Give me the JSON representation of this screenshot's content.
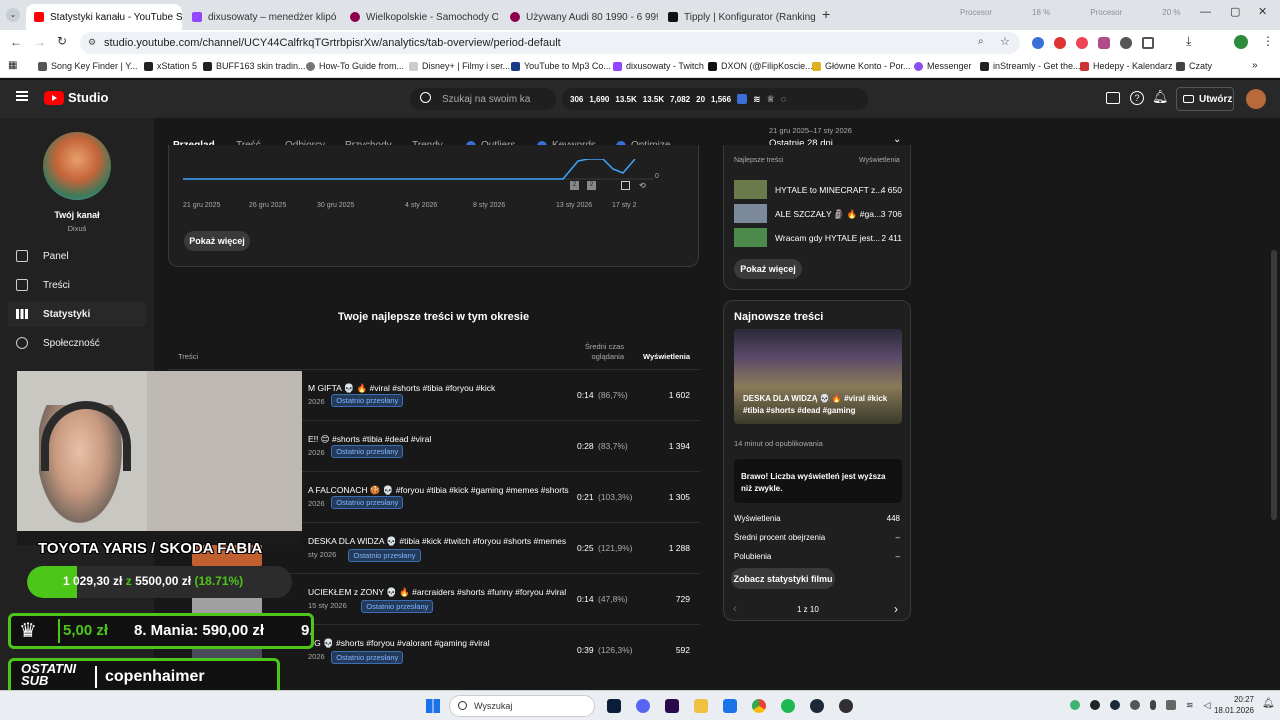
{
  "browser": {
    "tabs": [
      {
        "label": "Statystyki kanału - YouTube St",
        "active": true,
        "color": "#ff0000"
      },
      {
        "label": "dixusowaty – menedżer klipów",
        "active": false,
        "color": "#9146ff"
      },
      {
        "label": "Wielkopolskie - Samochody O",
        "active": false,
        "color": "#8b0050"
      },
      {
        "label": "Używany Audi 80 1990 - 6 999",
        "active": false,
        "color": "#8b0050"
      },
      {
        "label": "Tipply | Konfigurator (Ranking",
        "active": false,
        "color": "#111111"
      }
    ],
    "new_tab": "+",
    "url": "studio.youtube.com/channel/UCY44CalfrkqTGrtrbpisrXw/analytics/tab-overview/period-default",
    "bookmarks": [
      "Song Key Finder | Y...",
      "xStation 5",
      "BUFF163 skin tradin...",
      "How-To Guide from...",
      "Disney+ | Filmy i ser...",
      "YouTube to Mp3 Co...",
      "dixusowaty - Twitch",
      "DXON (@FilipKoscie...",
      "Główne Konto - Por...",
      "Messenger",
      "inStreamly - Get the...",
      "Hedepy - Kalendarz",
      "Czaty"
    ],
    "overlay_tiny": [
      "Procesor",
      "18 %",
      "Procesor",
      "20 %"
    ]
  },
  "studio": {
    "logo": "Studio",
    "search_placeholder": "Szukaj na swoim ka",
    "stats": [
      "306",
      "1,690",
      "13.5K",
      "13.5K",
      "7,082",
      "20",
      "1,566"
    ],
    "create_label": "Utwórz"
  },
  "sidebar": {
    "channel_label": "Twój kanał",
    "channel_name": "Dixuś",
    "items": [
      {
        "label": "Panel"
      },
      {
        "label": "Treści"
      },
      {
        "label": "Statystyki",
        "active": true
      },
      {
        "label": "Społeczność"
      }
    ]
  },
  "analytics": {
    "tabs": [
      "Przegląd",
      "Treść",
      "Odbiorcy",
      "Przychody",
      "Trendy",
      "Outliers",
      "Keywords",
      "Optimize"
    ],
    "period_range": "21 gru 2025–17 sty 2026",
    "period_label": "Ostatnie 28 dni",
    "chart_xticks": [
      "21 gru 2025",
      "26 gru 2025",
      "30 gru 2025",
      "4 sty 2026",
      "8 sty 2026",
      "13 sty 2026",
      "17 sty 2"
    ],
    "chart_zero": "0",
    "show_more": "Pokaż więcej",
    "top_content_title": "Twoje najlepsze treści w tym okresie",
    "col_content": "Treści",
    "col_avg": "Średni czas oglądania",
    "col_views": "Wyświetlenia",
    "rows": [
      {
        "title": "M GIFTA 💀 🔥 #viral #shorts #tibia #foryou #kick",
        "date": "2026",
        "badge": "Ostatnio przesłany",
        "avg": "0:14",
        "pct": "(86,7%)",
        "views": "1 602"
      },
      {
        "title": "E!! 😊 #shorts #tibia #dead #viral",
        "date": "2026",
        "badge": "Ostatnio przesłany",
        "avg": "0:28",
        "pct": "(83,7%)",
        "views": "1 394"
      },
      {
        "title": "A FALCONACH 🍪 💀 #foryou #tibia #kick #gaming #memes #shorts",
        "date": "2026",
        "badge": "Ostatnio przesłany",
        "avg": "0:21",
        "pct": "(103,3%)",
        "views": "1 305"
      },
      {
        "title": "DESKA DLA WIDZA 💀 #tibia #kick #twitch #foryou #shorts #memes",
        "date": "sty 2026",
        "badge": "Ostatnio przesłany",
        "avg": "0:25",
        "pct": "(121,9%)",
        "views": "1 288"
      },
      {
        "title": "UCIEKŁEM z ZONY 💀 🔥 #arcraiders #shorts #funny #foryou #viral",
        "date": "15 sty 2026",
        "badge": "Ostatnio przesłany",
        "avg": "0:14",
        "pct": "(47,8%)",
        "views": "729"
      },
      {
        "title": "NG 💀 #shorts #foryou #valorant #gaming #viral",
        "date": "2026",
        "badge": "Ostatnio przesłany",
        "avg": "0:39",
        "pct": "(126,3%)",
        "views": "592"
      }
    ]
  },
  "right": {
    "top_header_left": "Najlepsze treści",
    "top_header_right": "Wyświetlenia",
    "top_items": [
      {
        "title": "HYTALE to MINECRAFT z...",
        "views": "4 650"
      },
      {
        "title": "ALE SZCZAŁY 🗿 🔥 #ga...",
        "views": "3 706"
      },
      {
        "title": "Wracam gdy HYTALE jest...",
        "views": "2 411"
      }
    ],
    "show_more": "Pokaż więcej",
    "latest_title": "Najnowsze treści",
    "latest_video_title": "DESKA DLA WIDZĄ 💀 🔥 #viral #kick #tibia #shorts #dead #gaming",
    "published_ago": "14 minut od opublikowania",
    "note": "Brawo! Liczba wyświetleń jest wyższa niż zwykle.",
    "metrics": [
      {
        "label": "Wyświetlenia",
        "value": "448"
      },
      {
        "label": "Średni procent obejrzenia",
        "value": "–"
      },
      {
        "label": "Polubienia",
        "value": "–"
      }
    ],
    "stats_button": "Zobacz statystyki filmu",
    "pager": "1 z 10"
  },
  "overlay": {
    "goal_title": "TOYOTA YARIS / SKODA FABIA",
    "goal_amount": "1 029,30 zł",
    "goal_of": "z",
    "goal_target": "5500,00 zł",
    "goal_pct": "(18.71%)",
    "goal_fraction": 0.1871,
    "ranking_first": "5,00 zł",
    "ranking_second": "8. Mania: 590,00 zł",
    "ranking_third": "9.",
    "last_sub_label": "OSTATNI SUB",
    "last_sub_name": "copenhaimer"
  },
  "taskbar": {
    "search": "Wyszukaj",
    "time": "20:27",
    "date": "18.01.2026"
  }
}
